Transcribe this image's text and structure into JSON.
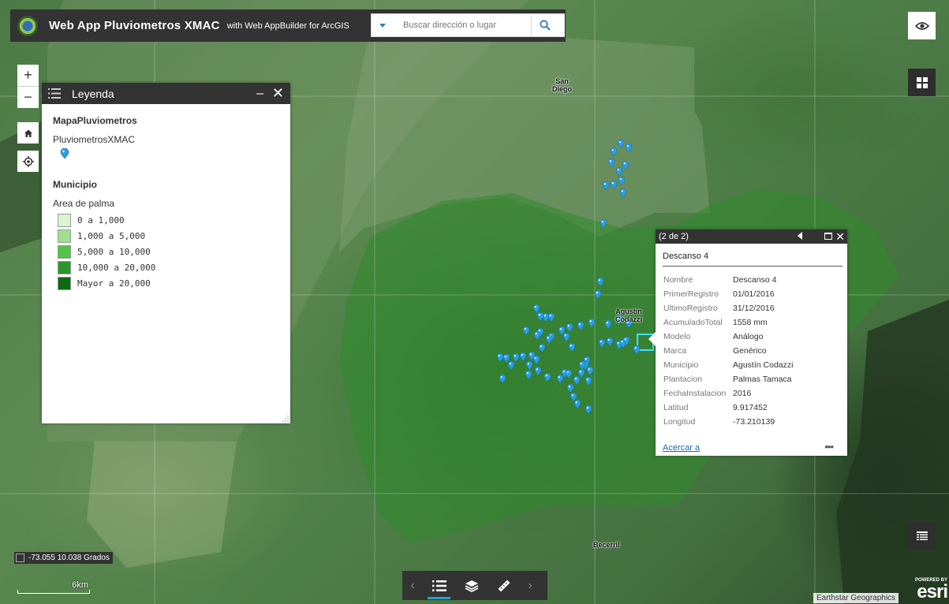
{
  "header": {
    "title": "Web App Pluviometros XMAC",
    "subtitle": "with Web AppBuilder for ArcGIS",
    "search_placeholder": "Buscar dirección o lugar"
  },
  "map": {
    "places": [
      {
        "name": "San\nDiego"
      },
      {
        "name": "Agustín\nCodazzi"
      },
      {
        "name": "Becerril"
      }
    ]
  },
  "legend": {
    "title": "Leyenda",
    "layer1": "MapaPluviometros",
    "layer1_sub": "PluviometrosXMAC",
    "layer2": "Municipio",
    "layer2_sub": "Area de palma",
    "classes": [
      {
        "label": "0 a 1,000",
        "color": "#d8f5d0"
      },
      {
        "label": "1,000 a 5,000",
        "color": "#9ee28e"
      },
      {
        "label": "5,000 a 10,000",
        "color": "#52c447"
      },
      {
        "label": "10,000 a 20,000",
        "color": "#28982a"
      },
      {
        "label": "Mayor a 20,000",
        "color": "#0b6a12"
      }
    ]
  },
  "popup": {
    "count": "(2 de 2)",
    "title": "Descanso 4",
    "fields": [
      {
        "key": "Nombre",
        "value": "Descanso 4"
      },
      {
        "key": "PrimerRegistro",
        "value": "01/01/2016"
      },
      {
        "key": "UltimoRegistro",
        "value": "31/12/2016"
      },
      {
        "key": "AcumuladoTotal",
        "value": "1558 mm"
      },
      {
        "key": "Modelo",
        "value": "Análogo"
      },
      {
        "key": "Marca",
        "value": "Genérico"
      },
      {
        "key": "Municipio",
        "value": "Agustín Codazzi"
      },
      {
        "key": "Plantacion",
        "value": "Palmas Tamaca"
      },
      {
        "key": "FechaInstalacion",
        "value": "2016"
      },
      {
        "key": "Latitud",
        "value": "9.917452"
      },
      {
        "key": "Longitud",
        "value": "-73.210139"
      }
    ],
    "zoom_link": "Acercar a",
    "more": "•••"
  },
  "coords": "-73.055 10.038 Grados",
  "scale_label": "6km",
  "attribution": "Earthstar Geographics",
  "esri": {
    "powered": "POWERED BY",
    "name": "esri"
  },
  "colors": {
    "accent": "#24a0d8",
    "pin": "#2a9ee0",
    "header_bg": "#333333"
  }
}
